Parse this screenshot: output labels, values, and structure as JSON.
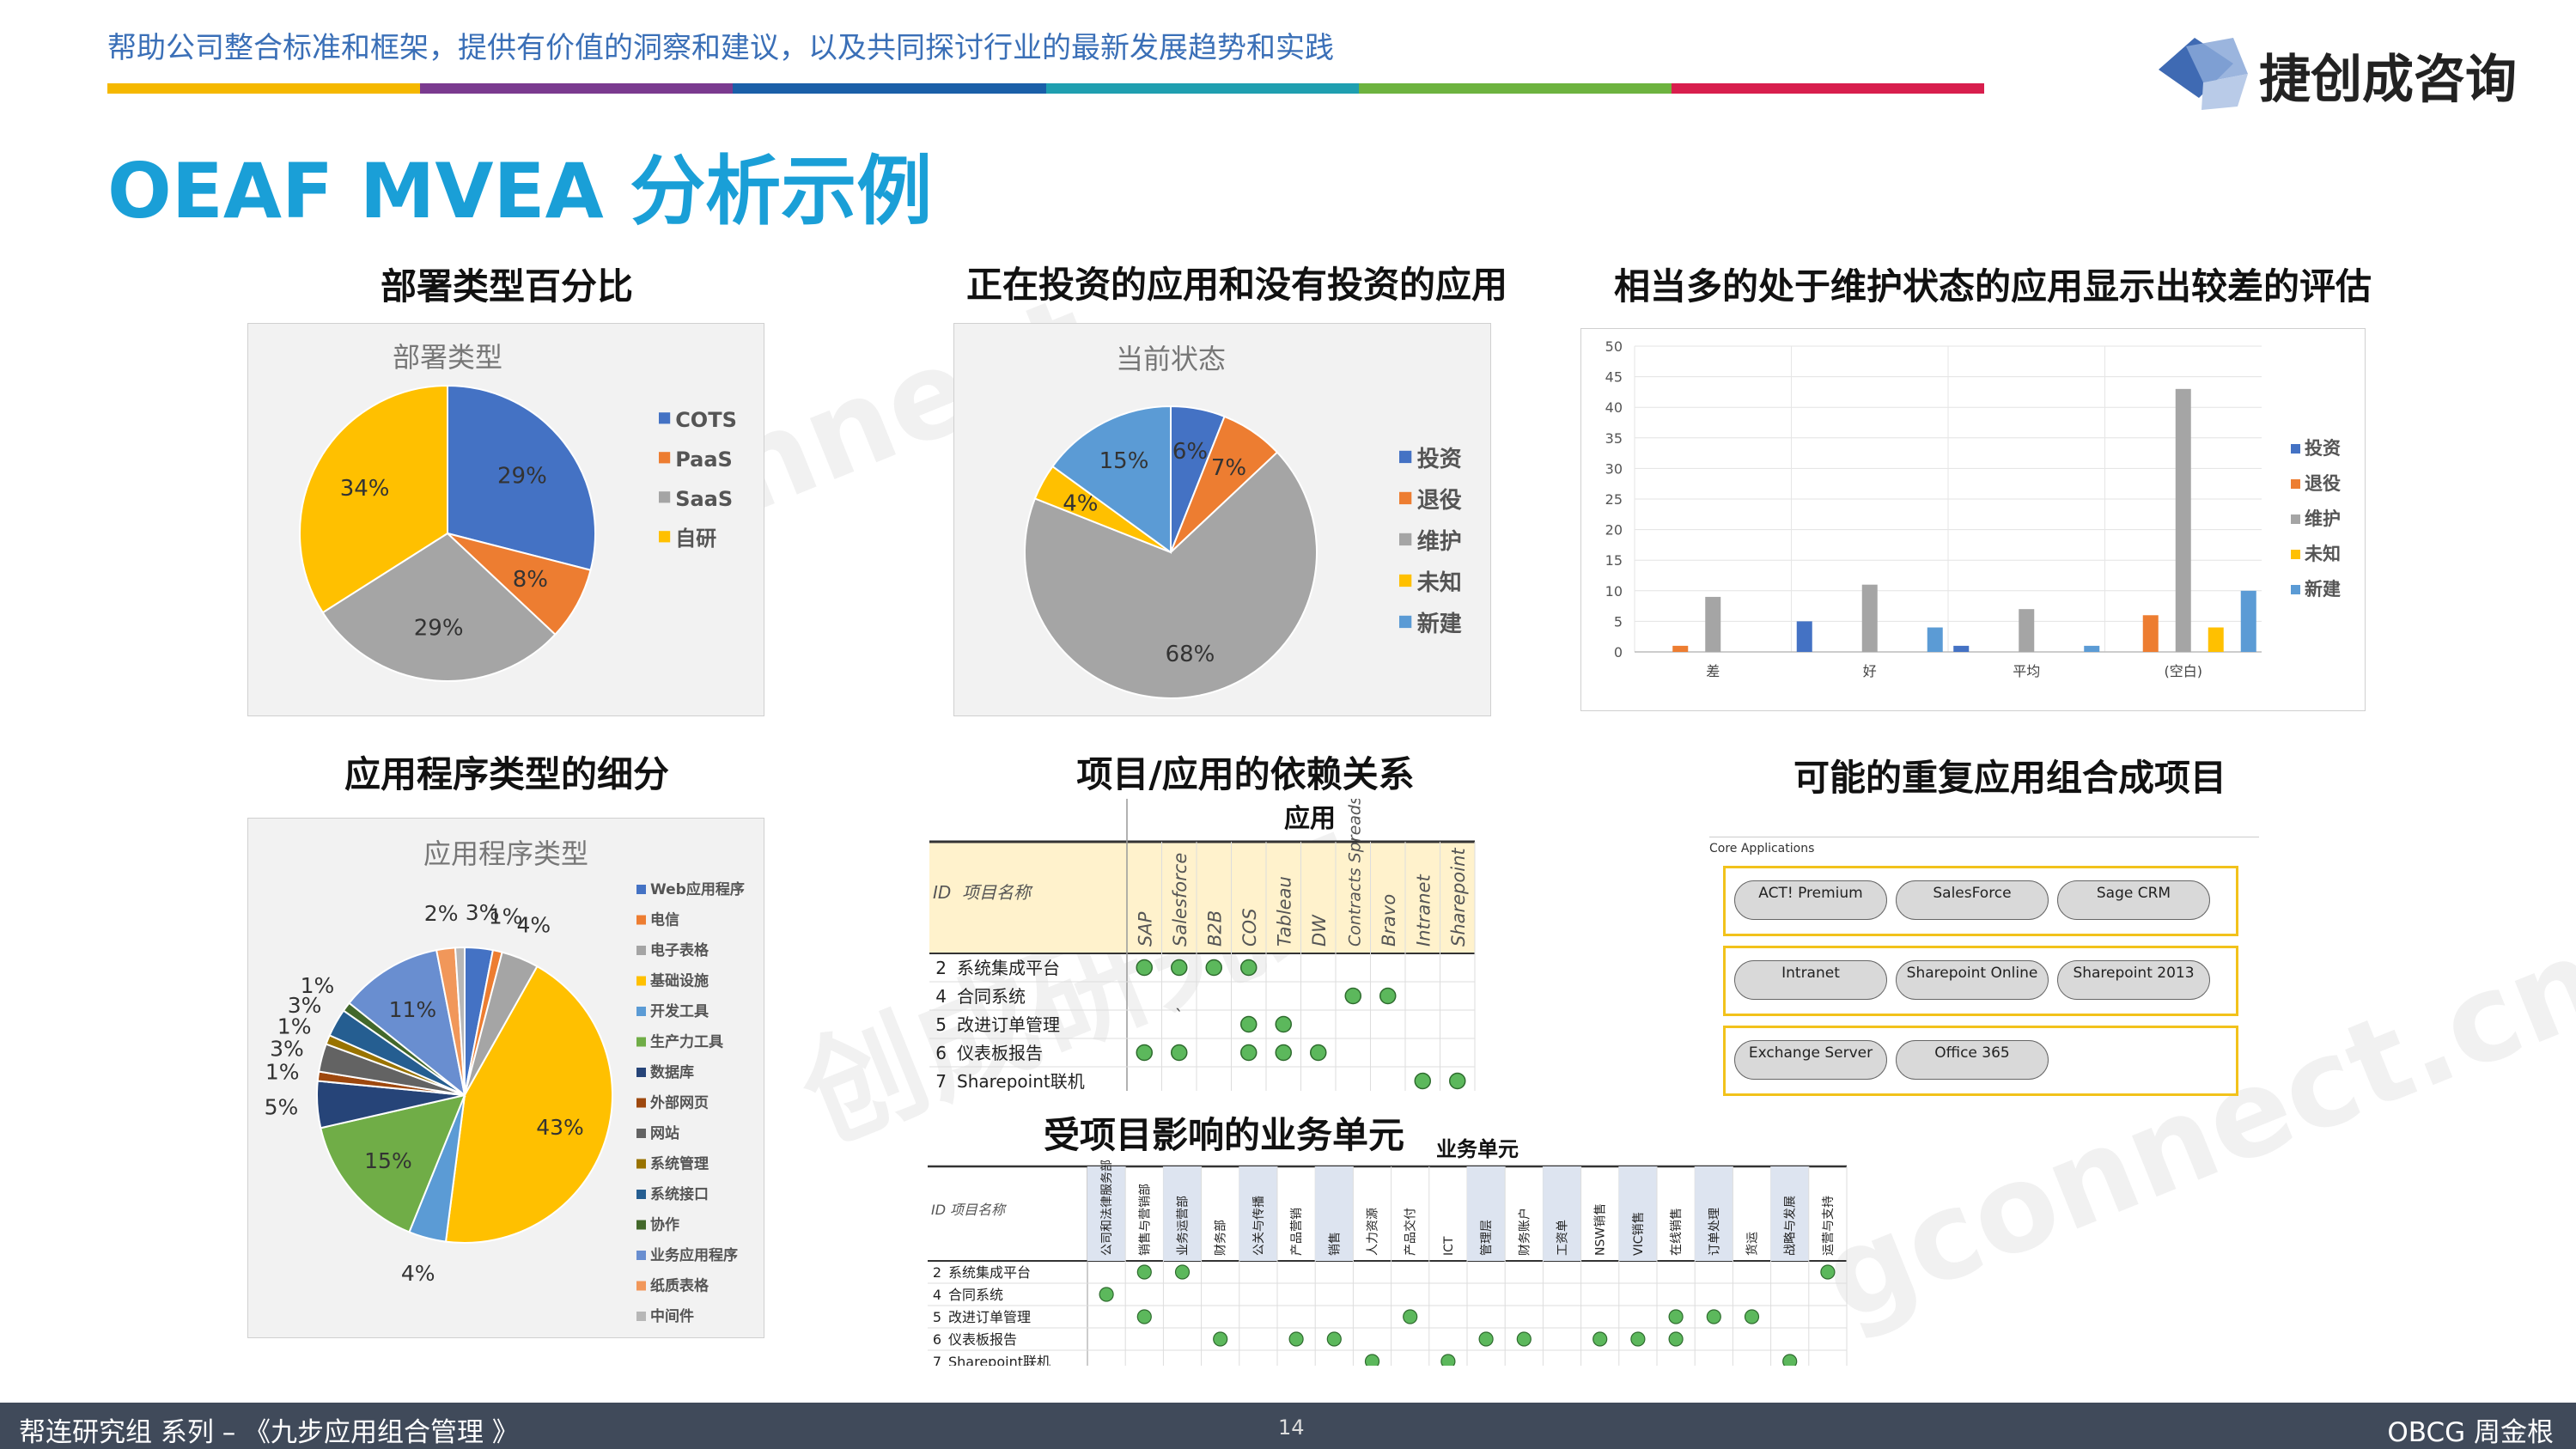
{
  "header": {
    "tagline": "帮助公司整合标准和框架，提供有价值的洞察和建议，以及共同探讨行业的最新发展趋势和实践",
    "logo_text": "捷创成咨询",
    "bar_colors": [
      "#f5b800",
      "#7a3a8f",
      "#1a5fa8",
      "#1f9fb0",
      "#6db33f",
      "#d81e4d"
    ]
  },
  "page_title": "OEAF MVEA 分析示例",
  "sections": {
    "deploy": "部署类型百分比",
    "invest": "正在投资的应用和没有投资的应用",
    "maint": "相当多的处于维护状态的应用显示出较差的评估",
    "apptype": "应用程序类型的细分",
    "dep": "项目/应用的依赖关系",
    "combine": "可能的重复应用组合成项目",
    "bu": "受项目影响的业务单元"
  },
  "chart_data": [
    {
      "type": "pie",
      "title": "部署类型",
      "categories": [
        "COTS",
        "PaaS",
        "SaaS",
        "自研"
      ],
      "values": [
        29,
        8,
        29,
        34
      ],
      "colors": [
        "#4472c4",
        "#ed7d31",
        "#a5a5a5",
        "#ffc000"
      ]
    },
    {
      "type": "pie",
      "title": "当前状态",
      "categories": [
        "投资",
        "退役",
        "维护",
        "未知",
        "新建"
      ],
      "values": [
        6,
        7,
        68,
        4,
        15
      ],
      "colors": [
        "#4472c4",
        "#ed7d31",
        "#a5a5a5",
        "#ffc000",
        "#5b9bd5"
      ]
    },
    {
      "type": "bar",
      "categories": [
        "差",
        "好",
        "平均",
        "(空白)"
      ],
      "series": [
        {
          "name": "投资",
          "color": "#4472c4",
          "values": [
            0,
            5,
            1,
            0
          ]
        },
        {
          "name": "退役",
          "color": "#ed7d31",
          "values": [
            1,
            0,
            0,
            6
          ]
        },
        {
          "name": "维护",
          "color": "#a5a5a5",
          "values": [
            9,
            11,
            7,
            43
          ]
        },
        {
          "name": "未知",
          "color": "#ffc000",
          "values": [
            0,
            0,
            0,
            4
          ]
        },
        {
          "name": "新建",
          "color": "#5b9bd5",
          "values": [
            0,
            4,
            1,
            10
          ]
        }
      ],
      "ylim": [
        0,
        50
      ],
      "yticks": [
        0,
        5,
        10,
        15,
        20,
        25,
        30,
        35,
        40,
        45,
        50
      ]
    },
    {
      "type": "pie",
      "title": "应用程序类型",
      "categories": [
        "Web应用程序",
        "电信",
        "电子表格",
        "基础设施",
        "开发工具",
        "生产力工具",
        "数据库",
        "外部网页",
        "网站",
        "系统管理",
        "系统接口",
        "协作",
        "业务应用程序",
        "纸质表格",
        "中间件"
      ],
      "values": [
        3,
        1,
        4,
        43,
        4,
        15,
        5,
        1,
        3,
        1,
        3,
        1,
        11,
        2,
        1
      ],
      "labels": [
        "3%",
        "1%",
        "4%",
        "43%",
        "4%",
        "15%",
        "5%",
        "1%",
        "3%",
        "1%",
        "3%",
        "1%",
        "11%",
        "2%",
        "1%"
      ],
      "show_label": [
        true,
        true,
        true,
        true,
        true,
        true,
        true,
        true,
        true,
        true,
        true,
        true,
        true,
        true,
        false
      ],
      "colors": [
        "#4472c4",
        "#ed7d31",
        "#a5a5a5",
        "#ffc000",
        "#5b9bd5",
        "#70ad47",
        "#264478",
        "#9e480e",
        "#636363",
        "#997300",
        "#255e91",
        "#43682b",
        "#698ed0",
        "#f1975a",
        "#b7b7b7"
      ]
    }
  ],
  "dependency": {
    "group_label": "应用",
    "id_label": "ID",
    "name_label": "项目名称",
    "apps": [
      "SAP",
      "Salesforce",
      "B2B",
      "COS",
      "Tableau",
      "DW",
      "Contracts Spreadshee",
      "Bravo",
      "Intranet",
      "Sharepoint"
    ],
    "rows": [
      {
        "id": "2",
        "name": "系统集成平台",
        "marks": [
          1,
          1,
          1,
          1,
          0,
          0,
          0,
          0,
          0,
          0
        ]
      },
      {
        "id": "4",
        "name": "合同系统",
        "marks": [
          0,
          0,
          0,
          0,
          0,
          0,
          1,
          1,
          0,
          0
        ]
      },
      {
        "id": "5",
        "name": "改进订单管理",
        "marks": [
          0,
          0,
          0,
          1,
          1,
          0,
          0,
          0,
          0,
          0
        ]
      },
      {
        "id": "6",
        "name": "仪表板报告",
        "marks": [
          1,
          1,
          0,
          1,
          1,
          1,
          0,
          0,
          0,
          0
        ]
      },
      {
        "id": "7",
        "name": "Sharepoint联机",
        "marks": [
          0,
          0,
          0,
          0,
          0,
          0,
          0,
          0,
          1,
          1
        ]
      }
    ],
    "stray_mark": "`"
  },
  "combine": {
    "header": "Core Applications",
    "groups": [
      [
        "ACT! Premium",
        "SalesForce",
        "Sage CRM"
      ],
      [
        "Intranet",
        "Sharepoint Online",
        "Sharepoint 2013"
      ],
      [
        "Exchange Server",
        "Office 365"
      ]
    ]
  },
  "business_units": {
    "group_label": "业务单元",
    "id_label": "ID",
    "name_label": "项目名称",
    "units": [
      "公司和法律服务部",
      "销售与营销部",
      "业务运营部",
      "财务部",
      "公关与传播",
      "产品营销",
      "销售",
      "人力资源",
      "产品交付",
      "ICT",
      "管理层",
      "财务账户",
      "工资单",
      "NSW销售",
      "VIC销售",
      "在线销售",
      "订单处理",
      "货运",
      "战略与发展",
      "运营与支持"
    ],
    "rows": [
      {
        "id": "2",
        "name": "系统集成平台",
        "marks": [
          0,
          1,
          1,
          0,
          0,
          0,
          0,
          0,
          0,
          0,
          0,
          0,
          0,
          0,
          0,
          0,
          0,
          0,
          0,
          1
        ]
      },
      {
        "id": "4",
        "name": "合同系统",
        "marks": [
          1,
          0,
          0,
          0,
          0,
          0,
          0,
          0,
          0,
          0,
          0,
          0,
          0,
          0,
          0,
          0,
          0,
          0,
          0,
          0
        ]
      },
      {
        "id": "5",
        "name": "改进订单管理",
        "marks": [
          0,
          1,
          0,
          0,
          0,
          0,
          0,
          0,
          1,
          0,
          0,
          0,
          0,
          0,
          0,
          1,
          1,
          1,
          0,
          0
        ]
      },
      {
        "id": "6",
        "name": "仪表板报告",
        "marks": [
          0,
          0,
          0,
          1,
          0,
          1,
          1,
          0,
          0,
          0,
          1,
          1,
          0,
          1,
          1,
          1,
          0,
          0,
          0,
          0
        ]
      },
      {
        "id": "7",
        "name": "Sharepoint联机",
        "marks": [
          0,
          0,
          0,
          0,
          0,
          0,
          0,
          1,
          0,
          1,
          0,
          0,
          0,
          0,
          0,
          0,
          0,
          0,
          1,
          0
        ]
      }
    ]
  },
  "footer": {
    "left": "帮连研究组 系列 – 《九步应用组合管理 》",
    "page": "14",
    "right": "OBCG 周金根"
  }
}
